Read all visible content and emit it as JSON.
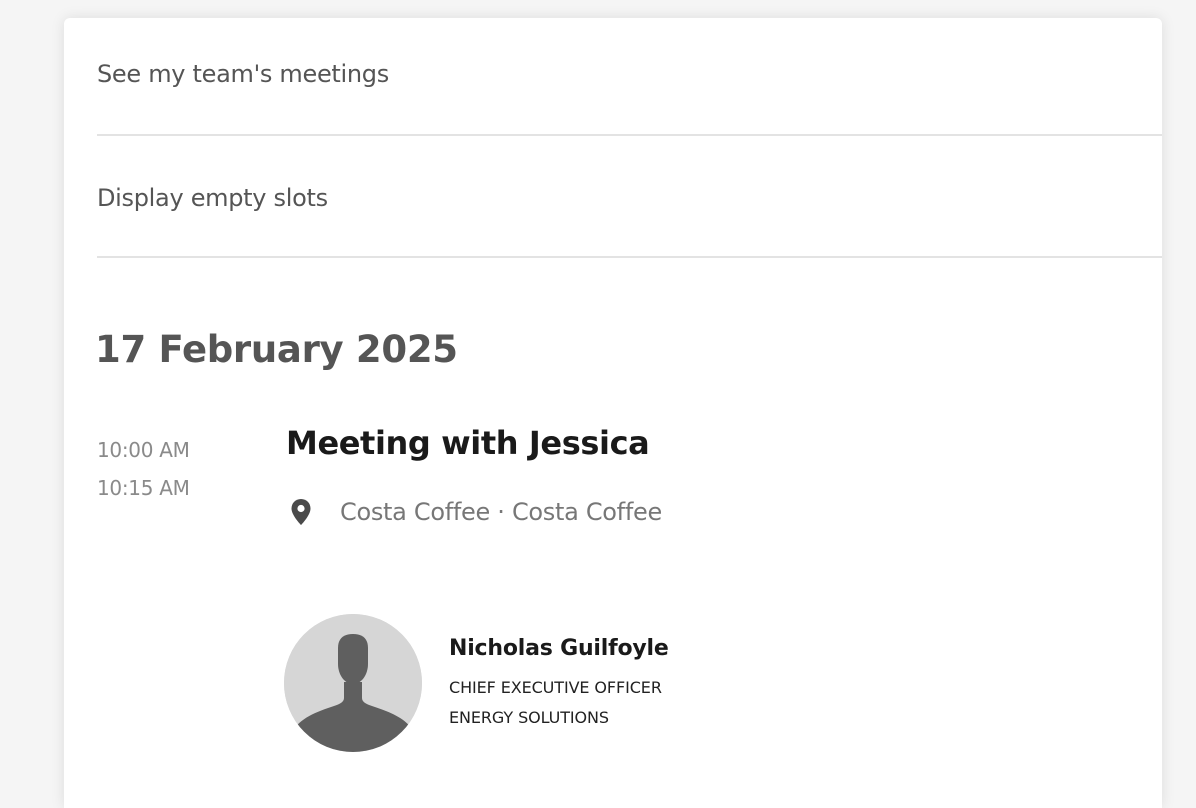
{
  "toggles": {
    "team_meetings_label": "See my team's meetings",
    "empty_slots_label": "Display empty slots"
  },
  "schedule": {
    "date": "17 February 2025",
    "meeting": {
      "start_time": "10:00 AM",
      "end_time": "10:15 AM",
      "title": "Meeting with Jessica",
      "location_icon": "map-pin-icon",
      "location": "Costa Coffee · Costa Coffee",
      "attendee": {
        "avatar_icon": "user-silhouette-icon",
        "name": "Nicholas Guilfoyle",
        "role": "CHIEF EXECUTIVE OFFICER",
        "company": "ENERGY SOLUTIONS"
      }
    }
  },
  "colors": {
    "text_muted": "#555555",
    "text_strong": "#1a1a1a",
    "time_text": "#8a8a8a",
    "avatar_bg": "#d6d6d6",
    "avatar_figure": "#5f5f5f"
  }
}
